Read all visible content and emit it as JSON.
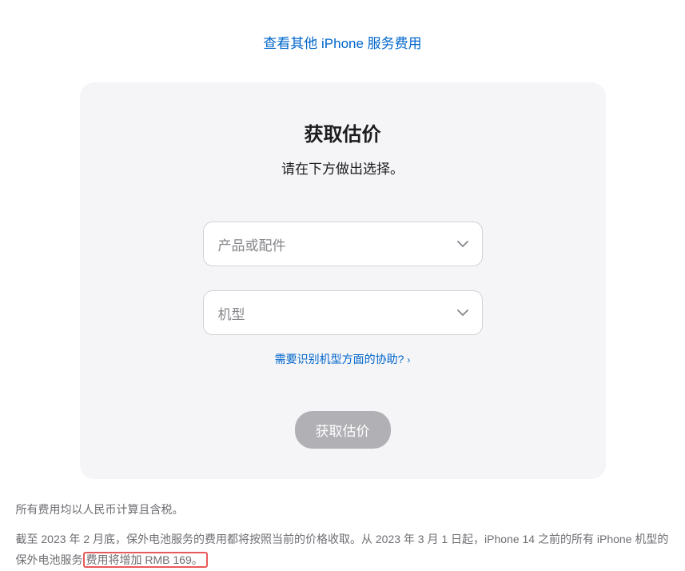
{
  "top_link": {
    "label": "查看其他 iPhone 服务费用"
  },
  "card": {
    "title": "获取估价",
    "subtitle": "请在下方做出选择。",
    "select_product_placeholder": "产品或配件",
    "select_model_placeholder": "机型",
    "help_link_label": "需要识别机型方面的协助?",
    "submit_label": "获取估价"
  },
  "footer": {
    "line1": "所有费用均以人民币计算且含税。",
    "line2_part1": "截至 2023 年 2 月底，保外电池服务的费用都将按照当前的价格收取。从 2023 年 3 月 1 日起，iPhone 14 之前的所有 iPhone 机型的保外电池服务",
    "line2_highlight": "费用将增加 RMB 169。"
  }
}
